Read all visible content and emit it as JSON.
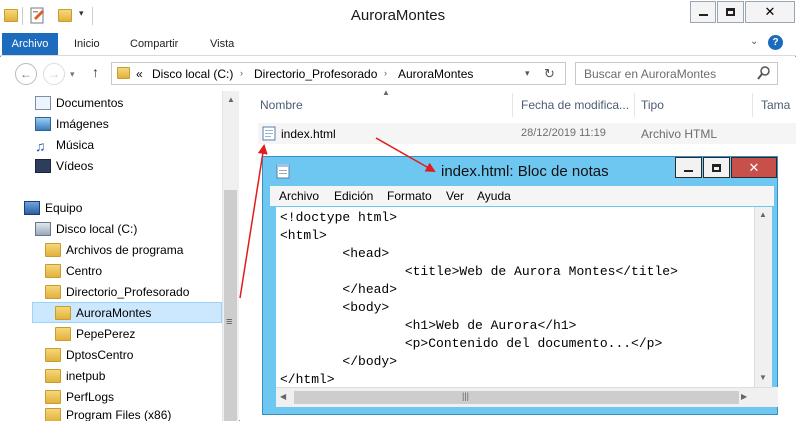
{
  "explorer": {
    "title": "AuroraMontes",
    "ribbon_tabs": [
      "Archivo",
      "Inicio",
      "Compartir",
      "Vista"
    ],
    "breadcrumb": [
      "«",
      "Disco local (C:)",
      "Directorio_Profesorado",
      "AuroraMontes"
    ],
    "search_placeholder": "Buscar en AuroraMontes",
    "sidebar": [
      {
        "label": "Documentos",
        "icon": "documents-icon"
      },
      {
        "label": "Imágenes",
        "icon": "pictures-icon"
      },
      {
        "label": "Música",
        "icon": "music-icon"
      },
      {
        "label": "Vídeos",
        "icon": "videos-icon"
      },
      {
        "label": "Equipo",
        "icon": "computer-icon"
      },
      {
        "label": "Disco local (C:)",
        "icon": "drive-icon"
      },
      {
        "label": "Archivos de programa",
        "icon": "folder-icon"
      },
      {
        "label": "Centro",
        "icon": "folder-icon"
      },
      {
        "label": "Directorio_Profesorado",
        "icon": "folder-icon"
      },
      {
        "label": "AuroraMontes",
        "icon": "folder-icon",
        "selected": true
      },
      {
        "label": "PepePerez",
        "icon": "folder-icon"
      },
      {
        "label": "DptosCentro",
        "icon": "folder-icon"
      },
      {
        "label": "inetpub",
        "icon": "folder-icon"
      },
      {
        "label": "PerfLogs",
        "icon": "folder-icon"
      },
      {
        "label": "Program Files (x86)",
        "icon": "folder-icon"
      }
    ],
    "columns": [
      "Nombre",
      "Fecha de modifica...",
      "Tipo",
      "Tama"
    ],
    "files": [
      {
        "name": "index.html",
        "date": "28/12/2019 11:19",
        "type": "Archivo HTML"
      }
    ]
  },
  "notepad": {
    "title": "index.html: Bloc de notas",
    "menu": [
      "Archivo",
      "Edición",
      "Formato",
      "Ver",
      "Ayuda"
    ],
    "lines": [
      "<!doctype html>",
      "<html>",
      "        <head>",
      "                <title>Web de Aurora Montes</title>",
      "        </head>",
      "        <body>",
      "                <h1>Web de Aurora</h1>",
      "                <p>Contenido del documento...</p>",
      "        </body>",
      "</html>"
    ]
  },
  "colors": {
    "accent": "#1c6bbf",
    "notepad_frame": "#6ec7f0",
    "arrow": "#e01c1c",
    "selection": "#cce8ff"
  }
}
